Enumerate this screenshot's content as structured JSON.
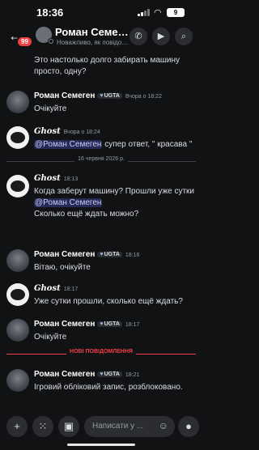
{
  "status_bar": {
    "time": "18:36",
    "battery": "9"
  },
  "header": {
    "unread_count": "99",
    "name": "Роман Семеген",
    "subtitle": "Новажливо, як повідомл..."
  },
  "messages": [
    {
      "kind": "continuation",
      "text": "Это настолько долго забирать машину просто, одну?"
    },
    {
      "kind": "message",
      "author": "Роман Семеген",
      "tag": "UGTA",
      "time": "Вчора о 18:22",
      "text": "Очікуйте"
    },
    {
      "kind": "message",
      "author": "Ghost",
      "time": "Вчора о 18:24",
      "mention": "@Роман Семеген",
      "text": " супер ответ, \" красава \""
    },
    {
      "kind": "date",
      "text": "16 червня 2026 р."
    },
    {
      "kind": "message",
      "author": "Ghost",
      "time": "18:13",
      "text1": "Когда заберут машину? Прошли уже сутки ",
      "mention": "@Роман Семеген",
      "text2": "Сколько ещё ждать можно?"
    },
    {
      "kind": "message",
      "author": "Роман Семеген",
      "tag": "UGTA",
      "time": "18:16",
      "text": "Вітаю, очікуйте"
    },
    {
      "kind": "message",
      "author": "Ghost",
      "time": "18:17",
      "text": "Уже сутки прошли, сколько ещё ждать?"
    },
    {
      "kind": "message",
      "author": "Роман Семеген",
      "tag": "UGTA",
      "time": "18:17",
      "text": "Очікуйте"
    },
    {
      "kind": "new_divider",
      "text": "НОВІ ПОВІДОМЛЕННЯ"
    },
    {
      "kind": "message",
      "author": "Роман Семеген",
      "tag": "UGTA",
      "time": "18:21",
      "text": "Ігровий обліковий запис, розблоковано."
    }
  ],
  "composer": {
    "placeholder": "Написати у ..."
  },
  "colors": {
    "background": "#111214",
    "mention": "#5865f2",
    "new_divider": "#f23f42"
  }
}
